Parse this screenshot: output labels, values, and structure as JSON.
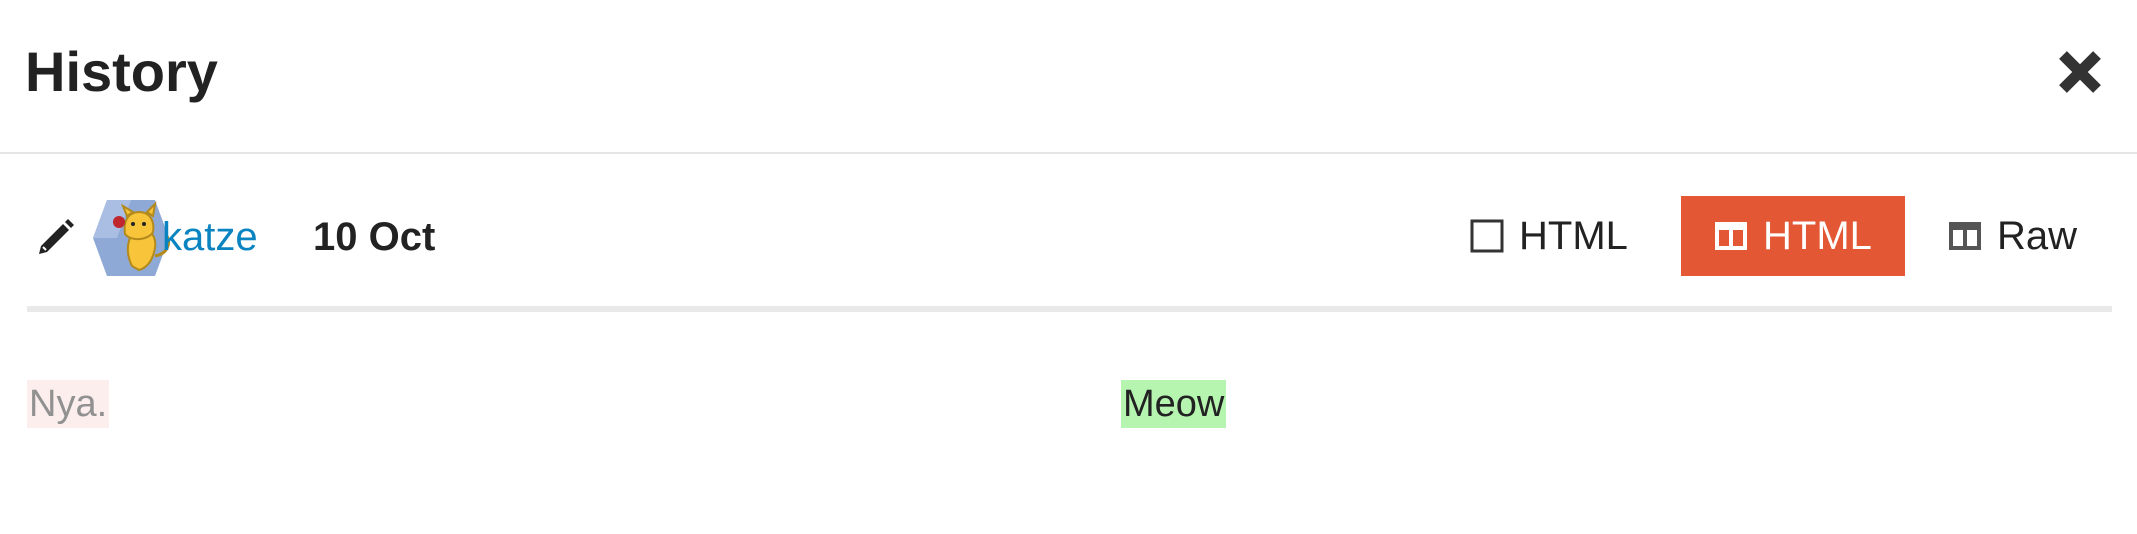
{
  "modal": {
    "title": "History"
  },
  "revision": {
    "username": "katze",
    "date": "10 Oct"
  },
  "view_modes": {
    "inline_label": "HTML",
    "side_by_side_label": "HTML",
    "raw_label": "Raw",
    "active": "side_by_side"
  },
  "diff": {
    "previous": "Nya.",
    "current": "Meow"
  },
  "colors": {
    "accent": "#e45735",
    "link": "#0a84c1",
    "deleted_bg": "#fdeeee",
    "inserted_bg": "#b5f5b0"
  },
  "icons": {
    "close": "close-icon",
    "edit": "pencil-icon",
    "inline": "checkbox-square-icon",
    "side_by_side": "columns-icon",
    "raw": "columns-icon"
  }
}
